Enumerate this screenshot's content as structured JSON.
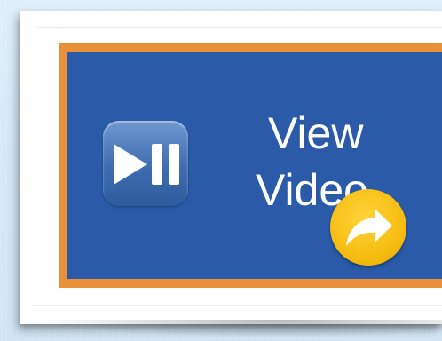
{
  "video_tile": {
    "label_line_1": "View",
    "label_line_2": "Video",
    "icons": {
      "play_pause": "play-pause-icon",
      "share": "share-arrow-icon"
    }
  },
  "colors": {
    "tile_border": "#e8903a",
    "tile_fill": "#2a5aa8",
    "share_badge": "#f6bd12",
    "label_text": "#ffffff"
  }
}
